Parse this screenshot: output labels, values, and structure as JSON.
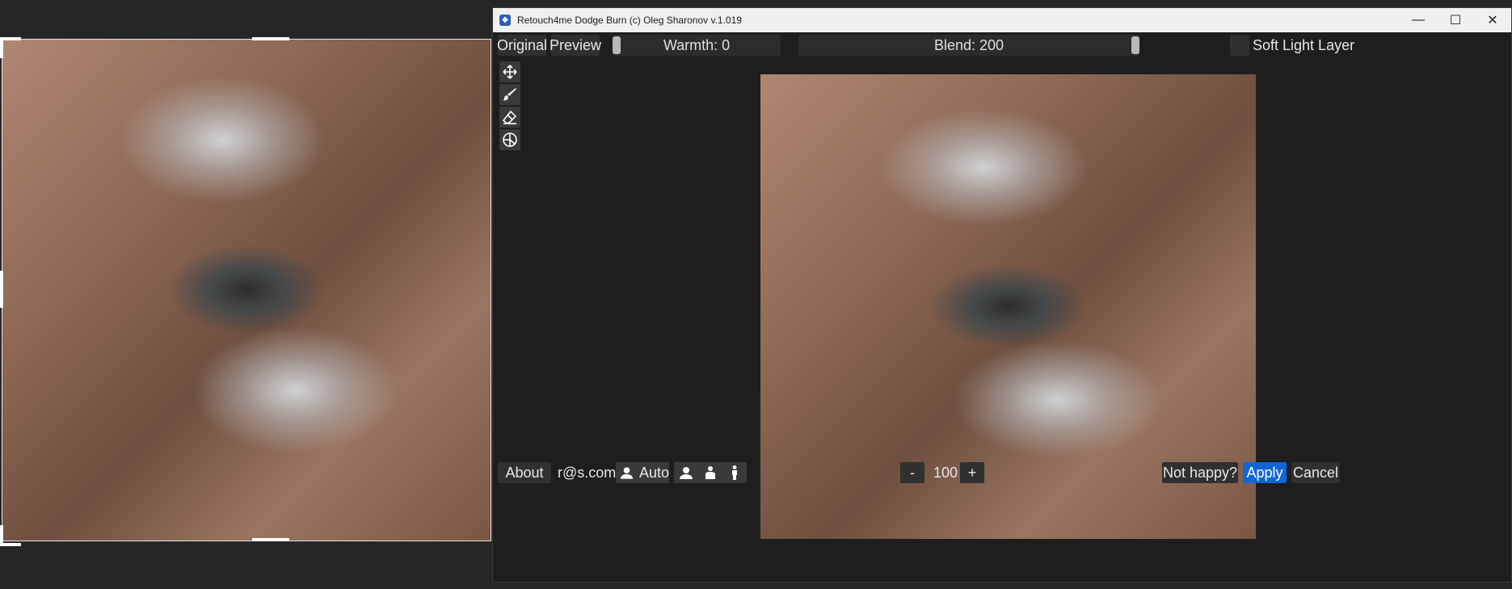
{
  "window": {
    "title": "Retouch4me Dodge Burn (c) Oleg Sharonov v.1.019",
    "minimize_symbol": "—",
    "maximize_symbol": "☐",
    "close_symbol": "✕"
  },
  "toolbar": {
    "original_label": "Original",
    "preview_label": "Preview",
    "warmth_label": "Warmth: 0",
    "warmth_value": 0,
    "blend_label": "Blend: 200",
    "blend_value": 200,
    "soft_light_label": "Soft Light Layer",
    "soft_light_checked": false
  },
  "tools": [
    {
      "name": "move-icon"
    },
    {
      "name": "brush-icon"
    },
    {
      "name": "eraser-icon"
    },
    {
      "name": "mask-icon"
    }
  ],
  "bottom": {
    "about_label": "About",
    "email": "r@s.com",
    "auto_label": "Auto",
    "zoom_minus": "-",
    "zoom_value": "100",
    "zoom_plus": "+",
    "not_happy_label": "Not happy?",
    "apply_label": "Apply",
    "cancel_label": "Cancel"
  },
  "colors": {
    "accent": "#1166d6",
    "background": "#1e1e1e",
    "button": "#303030"
  }
}
